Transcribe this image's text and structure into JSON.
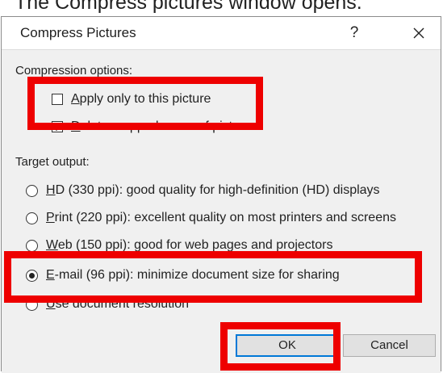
{
  "caption": "The Compress pictures window opens.",
  "dialog": {
    "title": "Compress Pictures",
    "help_label": "?",
    "compression_options": {
      "label": "Compression options:",
      "apply_only_prefix": "",
      "apply_only_mnemonic": "A",
      "apply_only_rest": "pply only to this picture",
      "apply_only_checked": false,
      "delete_cropped_prefix": "",
      "delete_cropped_mnemonic": "D",
      "delete_cropped_rest": "elete cropped areas of pictures",
      "delete_cropped_checked": true
    },
    "target_output": {
      "label": "Target output:",
      "options": [
        {
          "mnemonic": "H",
          "rest": "D (330 ppi): good quality for high-definition (HD) displays",
          "selected": false
        },
        {
          "mnemonic": "P",
          "rest": "rint (220 ppi): excellent quality on most printers and screens",
          "selected": false
        },
        {
          "mnemonic": "W",
          "rest": "eb (150 ppi): good for web pages and projectors",
          "selected": false
        },
        {
          "mnemonic": "E",
          "rest": "-mail (96 ppi): minimize document size for sharing",
          "selected": true
        },
        {
          "mnemonic": "U",
          "rest": "se document resolution",
          "selected": false
        }
      ]
    },
    "ok_label": "OK",
    "cancel_label": "Cancel"
  },
  "colors": {
    "highlight": "#ee0000",
    "dialog_bg": "#f0f0f0",
    "default_button_border": "#0078d7"
  }
}
